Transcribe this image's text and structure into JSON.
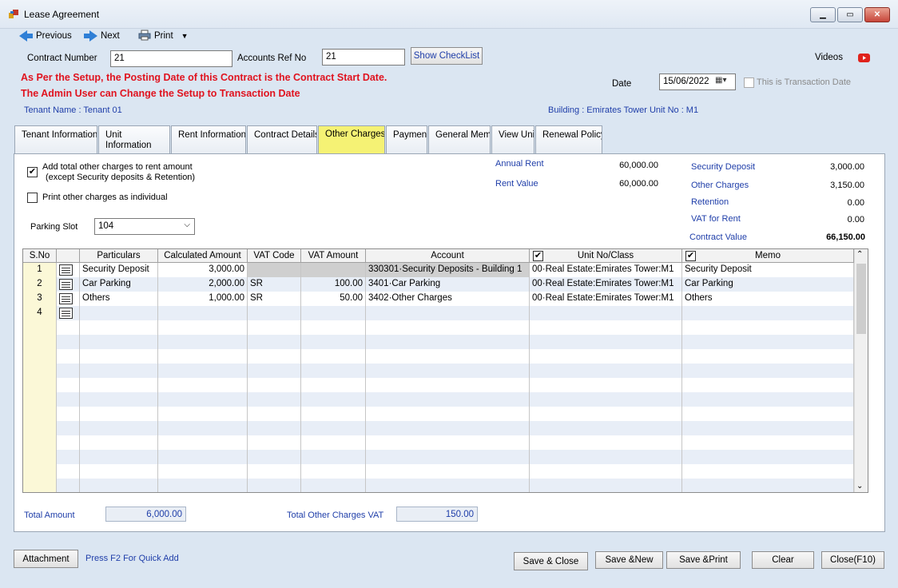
{
  "window": {
    "title": "Lease Agreement"
  },
  "toolbar": {
    "previous": "Previous",
    "next": "Next",
    "print": "Print"
  },
  "header": {
    "contract_number_label": "Contract Number",
    "contract_number": "21",
    "accounts_ref_label": "Accounts Ref No",
    "accounts_ref": "21",
    "show_checklist": "Show CheckList",
    "videos": "Videos",
    "warning_line1": "As Per the Setup, the Posting Date of this Contract is the Contract Start Date.",
    "warning_line2": "The Admin User can Change the Setup to Transaction Date",
    "date_label": "Date",
    "date_value": "15/06/2022",
    "transaction_date_label": "This is Transaction Date",
    "tenant_line": "Tenant Name : Tenant 01",
    "building_line": "Building : Emirates Tower  Unit No : M1"
  },
  "tabs": [
    "Tenant Information",
    "Unit Information",
    "Rent Information",
    "Contract Details",
    "Other Charges",
    "Payment",
    "General Memo",
    "View Unit",
    "Renewal Policy"
  ],
  "options": {
    "add_total_line1": "Add total other charges to rent amount",
    "add_total_line2": "(except Security deposits  & Retention)",
    "add_total_checked": true,
    "print_individual": "Print other charges as individual",
    "print_individual_checked": false,
    "parking_slot_label": "Parking Slot",
    "parking_slot": "104"
  },
  "summary": {
    "annual_rent_label": "Annual Rent",
    "annual_rent": "60,000.00",
    "rent_value_label": "Rent Value",
    "rent_value": "60,000.00",
    "security_deposit_label": "Security Deposit",
    "security_deposit": "3,000.00",
    "other_charges_label": "Other Charges",
    "other_charges": "3,150.00",
    "retention_label": "Retention",
    "retention": "0.00",
    "vat_for_rent_label": "VAT for Rent",
    "vat_for_rent": "0.00",
    "contract_value_label": "Contract Value",
    "contract_value": "66,150.00"
  },
  "grid": {
    "columns": [
      "S.No",
      "Particulars",
      "Calculated Amount",
      "VAT Code",
      "VAT Amount",
      "Account",
      "Unit No/Class",
      "Memo"
    ],
    "rows": [
      {
        "sno": "1",
        "particulars": "Security Deposit",
        "amount": "3,000.00",
        "vat_code": "",
        "vat_amount": "",
        "account": "330301·Security Deposits - Building 1",
        "unit": "00·Real Estate:Emirates Tower:M1",
        "memo": "Security Deposit"
      },
      {
        "sno": "2",
        "particulars": "Car Parking",
        "amount": "2,000.00",
        "vat_code": "SR",
        "vat_amount": "100.00",
        "account": "3401·Car Parking",
        "unit": "00·Real Estate:Emirates Tower:M1",
        "memo": "Car Parking"
      },
      {
        "sno": "3",
        "particulars": "Others",
        "amount": "1,000.00",
        "vat_code": "SR",
        "vat_amount": "50.00",
        "account": "3402·Other Charges",
        "unit": "00·Real Estate:Emirates Tower:M1",
        "memo": "Others"
      },
      {
        "sno": "4",
        "particulars": "",
        "amount": "",
        "vat_code": "",
        "vat_amount": "",
        "account": "",
        "unit": "",
        "memo": ""
      }
    ]
  },
  "totals": {
    "total_amount_label": "Total Amount",
    "total_amount": "6,000.00",
    "total_vat_label": "Total Other Charges VAT",
    "total_vat": "150.00"
  },
  "footer": {
    "attachment": "Attachment",
    "quick_add": "Press F2 For Quick Add",
    "save_close": "Save & Close",
    "save_new": "Save &New",
    "save_print": "Save &Print",
    "clear": "Clear",
    "close": "Close(F10)"
  }
}
